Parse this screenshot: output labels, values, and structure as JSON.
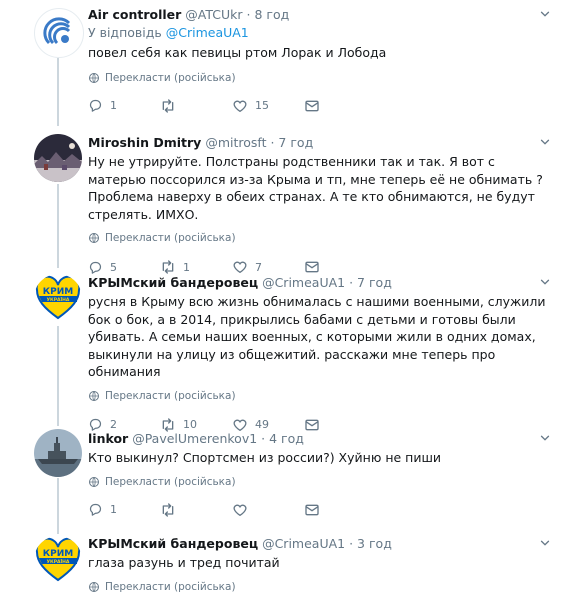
{
  "tweets": [
    {
      "name": "Air controller",
      "handle": "@ATCUkr",
      "time": "8 год",
      "reply_prefix": "У відповідь",
      "reply_handle": "@CrimeaUA1",
      "text": "повел себя как певицы ртом Лорак и Лобода",
      "translate": "Перекласти (російська)",
      "replies": "1",
      "retweets": "",
      "likes": "15"
    },
    {
      "name": "Miroshin Dmitry",
      "handle": "@mitrosft",
      "time": "7 год",
      "text": "Ну не утрируйте. Полстраны родственники так и так. Я вот с матерью поссорился из-за Крыма и тп, мне теперь её не обнимать ? Проблема наверху в обеих странах. А те кто обнимаются, не будут стрелять. ИМХО.",
      "translate": "Перекласти (російська)",
      "replies": "5",
      "retweets": "1",
      "likes": "7"
    },
    {
      "name": "КРЫМский бандеровец",
      "handle": "@CrimeaUA1",
      "time": "7 год",
      "avatar_label": "КРИМ",
      "avatar_sub": "УКРАЇНА",
      "text": "русня в Крыму всю жизнь обнималась с нашими военными, служили бок о бок, а в 2014, прикрылись бабами с детьми и готовы были убивать. А семьи наших военных, с которыми жили в одних домах, выкинули на улицу из общежитий. расскажи мне теперь про обнимания",
      "translate": "Перекласти (російська)",
      "replies": "2",
      "retweets": "10",
      "likes": "49"
    },
    {
      "name": "linkor",
      "handle": "@PavelUmerenkov1",
      "time": "4 год",
      "text": "Кто выкинул? Спортсмен из россии?) Хуйню не пиши",
      "translate": "Перекласти (російська)",
      "replies": "1",
      "retweets": "",
      "likes": ""
    },
    {
      "name": "КРЫМский бандеровец",
      "handle": "@CrimeaUA1",
      "time": "3 год",
      "avatar_label": "КРИМ",
      "avatar_sub": "УКРАЇНА",
      "text": "глаза разунь и тред почитай",
      "translate": "Перекласти (російська)"
    }
  ]
}
